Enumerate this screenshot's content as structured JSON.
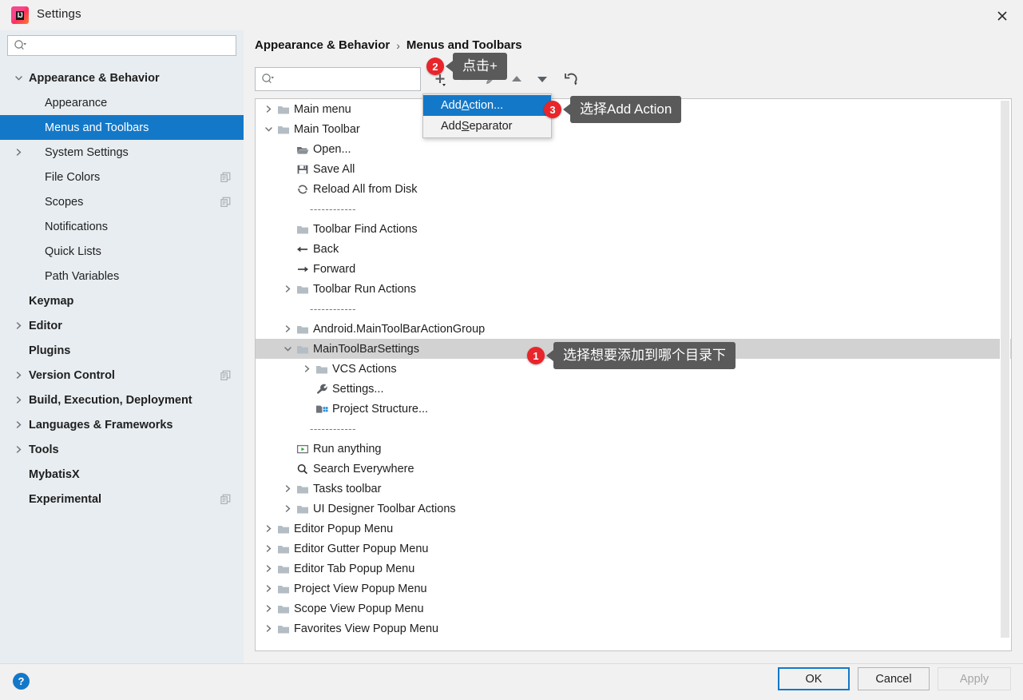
{
  "window": {
    "title": "Settings",
    "logo_text": "IJ",
    "close_icon": "close-icon"
  },
  "sidebar": {
    "search": {
      "placeholder": "",
      "value": "",
      "icon": "search-icon"
    },
    "items": [
      {
        "label": "Appearance & Behavior",
        "level": 1,
        "bold": true,
        "twisty": "chevron-down",
        "selected": false,
        "copy": false
      },
      {
        "label": "Appearance",
        "level": 2,
        "bold": false,
        "twisty": "",
        "selected": false,
        "copy": false
      },
      {
        "label": "Menus and Toolbars",
        "level": 2,
        "bold": false,
        "twisty": "",
        "selected": true,
        "copy": false
      },
      {
        "label": "System Settings",
        "level": 2,
        "bold": false,
        "twisty": "chevron-right",
        "selected": false,
        "copy": false
      },
      {
        "label": "File Colors",
        "level": 2,
        "bold": false,
        "twisty": "",
        "selected": false,
        "copy": true
      },
      {
        "label": "Scopes",
        "level": 2,
        "bold": false,
        "twisty": "",
        "selected": false,
        "copy": true
      },
      {
        "label": "Notifications",
        "level": 2,
        "bold": false,
        "twisty": "",
        "selected": false,
        "copy": false
      },
      {
        "label": "Quick Lists",
        "level": 2,
        "bold": false,
        "twisty": "",
        "selected": false,
        "copy": false
      },
      {
        "label": "Path Variables",
        "level": 2,
        "bold": false,
        "twisty": "",
        "selected": false,
        "copy": false
      },
      {
        "label": "Keymap",
        "level": 1,
        "bold": true,
        "twisty": "",
        "selected": false,
        "copy": false
      },
      {
        "label": "Editor",
        "level": 1,
        "bold": true,
        "twisty": "chevron-right",
        "selected": false,
        "copy": false
      },
      {
        "label": "Plugins",
        "level": 1,
        "bold": true,
        "twisty": "",
        "selected": false,
        "copy": false
      },
      {
        "label": "Version Control",
        "level": 1,
        "bold": true,
        "twisty": "chevron-right",
        "selected": false,
        "copy": true
      },
      {
        "label": "Build, Execution, Deployment",
        "level": 1,
        "bold": true,
        "twisty": "chevron-right",
        "selected": false,
        "copy": false
      },
      {
        "label": "Languages & Frameworks",
        "level": 1,
        "bold": true,
        "twisty": "chevron-right",
        "selected": false,
        "copy": false
      },
      {
        "label": "Tools",
        "level": 1,
        "bold": true,
        "twisty": "chevron-right",
        "selected": false,
        "copy": false
      },
      {
        "label": "MybatisX",
        "level": 1,
        "bold": true,
        "twisty": "",
        "selected": false,
        "copy": false
      },
      {
        "label": "Experimental",
        "level": 1,
        "bold": true,
        "twisty": "",
        "selected": false,
        "copy": true
      }
    ]
  },
  "main": {
    "breadcrumb": {
      "parent": "Appearance & Behavior",
      "separator": "›",
      "current": "Menus and Toolbars"
    },
    "search": {
      "placeholder": "",
      "value": "",
      "icon": "search-icon"
    },
    "toolbar": [
      {
        "name": "add-button",
        "icon": "plus-icon",
        "label": "+"
      },
      {
        "name": "remove-button",
        "icon": "minus-icon",
        "label": "−"
      },
      {
        "name": "edit-button",
        "icon": "pencil-icon",
        "label": "edit"
      },
      {
        "name": "move-up-button",
        "icon": "arrow-up-icon",
        "label": "up"
      },
      {
        "name": "move-down-button",
        "icon": "arrow-down-icon",
        "label": "down"
      },
      {
        "name": "restore-defaults-button",
        "icon": "revert-icon",
        "label": "restore"
      }
    ],
    "tree": [
      {
        "label": "Main menu",
        "indent": 0,
        "twisty": "chevron-right",
        "icon": "folder-icon",
        "selected": false
      },
      {
        "label": "Main Toolbar",
        "indent": 0,
        "twisty": "chevron-down",
        "icon": "folder-icon",
        "selected": false
      },
      {
        "label": "Open...",
        "indent": 1,
        "twisty": "",
        "icon": "open-folder-icon",
        "selected": false
      },
      {
        "label": "Save All",
        "indent": 1,
        "twisty": "",
        "icon": "save-icon",
        "selected": false
      },
      {
        "label": "Reload All from Disk",
        "indent": 1,
        "twisty": "",
        "icon": "refresh-icon",
        "selected": false
      },
      {
        "label": "------------",
        "indent": 1,
        "twisty": "",
        "icon": "separator",
        "selected": false
      },
      {
        "label": "Toolbar Find Actions",
        "indent": 1,
        "twisty": "",
        "icon": "folder-icon",
        "selected": false
      },
      {
        "label": "Back",
        "indent": 1,
        "twisty": "",
        "icon": "arrow-left-icon",
        "selected": false
      },
      {
        "label": "Forward",
        "indent": 1,
        "twisty": "",
        "icon": "arrow-right-icon",
        "selected": false
      },
      {
        "label": "Toolbar Run Actions",
        "indent": 1,
        "twisty": "chevron-right",
        "icon": "folder-icon",
        "selected": false
      },
      {
        "label": "------------",
        "indent": 1,
        "twisty": "",
        "icon": "separator",
        "selected": false
      },
      {
        "label": "Android.MainToolBarActionGroup",
        "indent": 1,
        "twisty": "chevron-right",
        "icon": "folder-icon",
        "selected": false
      },
      {
        "label": "MainToolBarSettings",
        "indent": 1,
        "twisty": "chevron-down",
        "icon": "folder-icon",
        "selected": true
      },
      {
        "label": "VCS Actions",
        "indent": 2,
        "twisty": "chevron-right",
        "icon": "folder-icon",
        "selected": false
      },
      {
        "label": "Settings...",
        "indent": 2,
        "twisty": "",
        "icon": "wrench-icon",
        "selected": false
      },
      {
        "label": "Project Structure...",
        "indent": 2,
        "twisty": "",
        "icon": "structure-icon",
        "selected": false
      },
      {
        "label": "------------",
        "indent": 1,
        "twisty": "",
        "icon": "separator",
        "selected": false
      },
      {
        "label": "Run anything",
        "indent": 1,
        "twisty": "",
        "icon": "run-icon",
        "selected": false
      },
      {
        "label": "Search Everywhere",
        "indent": 1,
        "twisty": "",
        "icon": "search-icon",
        "selected": false
      },
      {
        "label": "Tasks toolbar",
        "indent": 1,
        "twisty": "chevron-right",
        "icon": "folder-icon",
        "selected": false
      },
      {
        "label": "UI Designer Toolbar Actions",
        "indent": 1,
        "twisty": "chevron-right",
        "icon": "folder-icon",
        "selected": false
      },
      {
        "label": "Editor Popup Menu",
        "indent": 0,
        "twisty": "chevron-right",
        "icon": "folder-icon",
        "selected": false
      },
      {
        "label": "Editor Gutter Popup Menu",
        "indent": 0,
        "twisty": "chevron-right",
        "icon": "folder-icon",
        "selected": false
      },
      {
        "label": "Editor Tab Popup Menu",
        "indent": 0,
        "twisty": "chevron-right",
        "icon": "folder-icon",
        "selected": false
      },
      {
        "label": "Project View Popup Menu",
        "indent": 0,
        "twisty": "chevron-right",
        "icon": "folder-icon",
        "selected": false
      },
      {
        "label": "Scope View Popup Menu",
        "indent": 0,
        "twisty": "chevron-right",
        "icon": "folder-icon",
        "selected": false
      },
      {
        "label": "Favorites View Popup Menu",
        "indent": 0,
        "twisty": "chevron-right",
        "icon": "folder-icon",
        "selected": false
      }
    ]
  },
  "dropdown": {
    "items": [
      {
        "prefix": "Add ",
        "mnemonic": "A",
        "suffix": "ction...",
        "active": true
      },
      {
        "prefix": "Add ",
        "mnemonic": "S",
        "suffix": "eparator",
        "active": false
      }
    ]
  },
  "callouts": [
    {
      "number": "1",
      "text": "选择想要添加到哪个目录下"
    },
    {
      "number": "2",
      "text": "点击+"
    },
    {
      "number": "3",
      "text": "选择Add Action"
    }
  ],
  "footer": {
    "help_label": "?",
    "ok_label": "OK",
    "cancel_label": "Cancel",
    "apply_label": "Apply"
  },
  "colors": {
    "accent": "#1478c8",
    "badge": "#e8252a",
    "bubble": "#5a5a5a",
    "sidebar_bg": "#e8edf1",
    "selection_gray": "#d2d2d2"
  }
}
